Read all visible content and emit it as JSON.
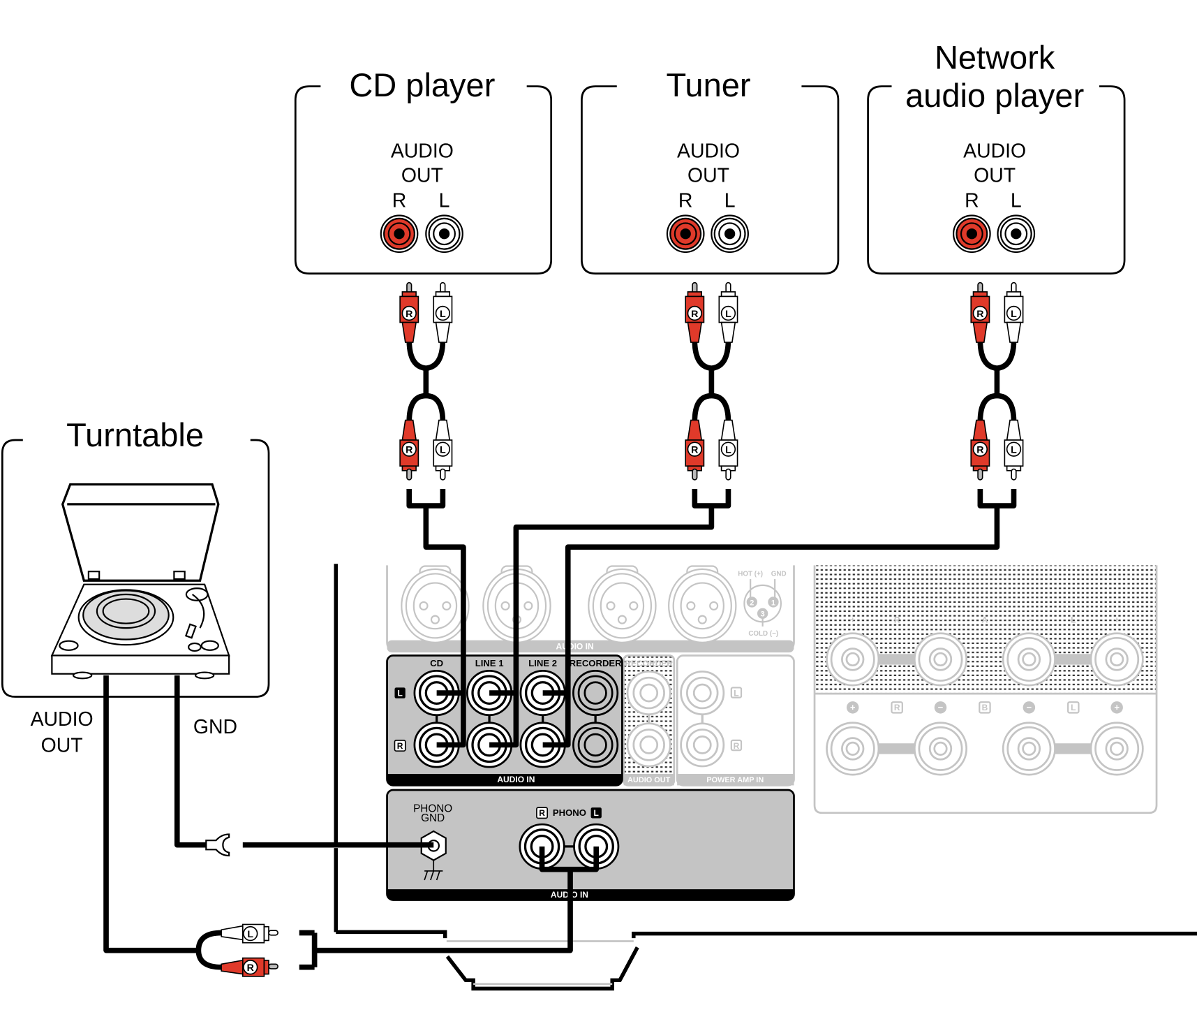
{
  "colors": {
    "red": "#E03A2A",
    "ink": "#000000",
    "panel_gray": "#c4c4c4",
    "faint_gray": "#c8c8c8",
    "white": "#ffffff"
  },
  "sources": [
    {
      "id": "cd",
      "title": "CD player",
      "port_label_1": "AUDIO",
      "port_label_2": "OUT",
      "r": "R",
      "l": "L"
    },
    {
      "id": "tuner",
      "title": "Tuner",
      "port_label_1": "AUDIO",
      "port_label_2": "OUT",
      "r": "R",
      "l": "L"
    },
    {
      "id": "network",
      "title_1": "Network",
      "title_2": "audio player",
      "port_label_1": "AUDIO",
      "port_label_2": "OUT",
      "r": "R",
      "l": "L"
    }
  ],
  "turntable": {
    "title": "Turntable",
    "audio_out_1": "AUDIO",
    "audio_out_2": "OUT",
    "gnd": "GND"
  },
  "plugs": {
    "r": "R",
    "l": "L"
  },
  "amp": {
    "xlr_section_label": "AUDIO IN",
    "xlr_legend": {
      "hot": "HOT (+)",
      "gnd": "GND",
      "cold": "COLD (−)",
      "pins": [
        "1",
        "2",
        "3"
      ]
    },
    "rca_inputs": [
      "CD",
      "LINE 1",
      "LINE 2",
      "RECORDER"
    ],
    "rca_section_label": "AUDIO IN",
    "channel_l": "L",
    "channel_r": "R",
    "recorder_out": "RECORDER",
    "audio_out_label": "AUDIO OUT",
    "power_amp_in_label": "POWER AMP IN",
    "phono_gnd_1": "PHONO",
    "phono_gnd_2": "GND",
    "phono_label": "PHONO",
    "phono_section_label": "AUDIO IN",
    "speaker_a": {
      "labels": [
        "+",
        "R",
        "−",
        "A",
        "−",
        "L",
        "+"
      ]
    },
    "speaker_b": {
      "labels": [
        "+",
        "R",
        "−",
        "B",
        "−",
        "L",
        "+"
      ]
    }
  }
}
